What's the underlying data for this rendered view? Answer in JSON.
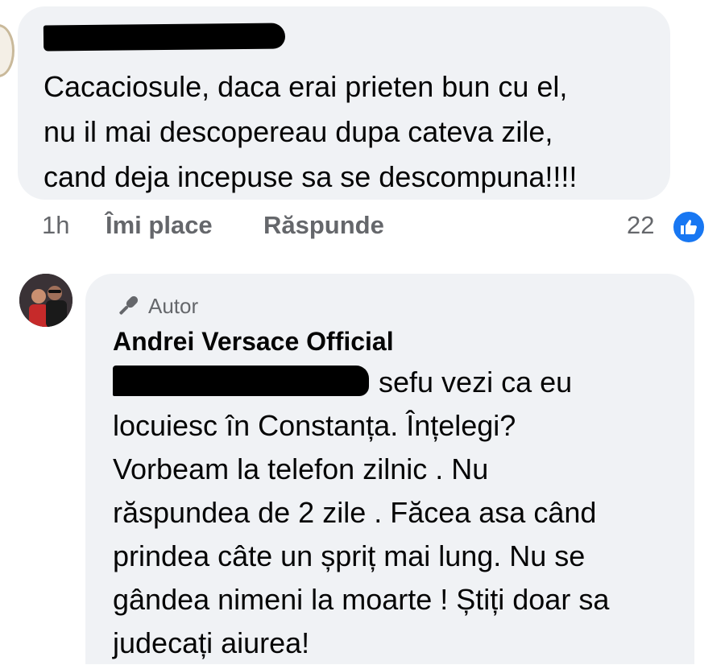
{
  "comment1": {
    "text_lines": [
      "Cacaciosule, daca erai prieten bun cu el,",
      "nu il mai descopereau dupa cateva zile,",
      "cand deja incepuse sa se descompuna!!!!"
    ],
    "time": "1h",
    "like_label": "Îmi place",
    "reply_label": "Răspunde",
    "reaction_count": "22",
    "reaction_icon": "thumbs-up-icon"
  },
  "comment2": {
    "badge_label": "Autor",
    "badge_icon": "microphone-icon",
    "author": "Andrei Versace Official",
    "text_lines": [
      "sefu vezi ca eu",
      "locuiesc în Constanța.  Înțelegi?",
      "Vorbeam la telefon zilnic . Nu",
      "răspundea de 2 zile . Făcea asa când",
      "prindea câte un șpriț mai lung. Nu se",
      "gândea nimeni la moarte ! Știți doar sa",
      "judecați aiurea!"
    ]
  },
  "colors": {
    "bubble": "#f0f2f5",
    "meta_text": "#65676b",
    "like_blue": "#1877f2"
  }
}
